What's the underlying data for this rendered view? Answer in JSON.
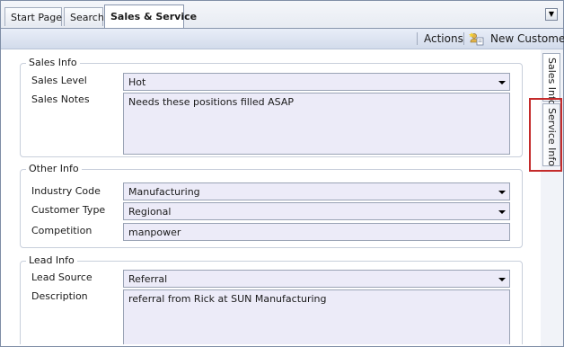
{
  "tabs": [
    {
      "label": "Start Page"
    },
    {
      "label": "Search"
    },
    {
      "label": "Sales & Service",
      "active": true
    }
  ],
  "toolbar": {
    "actions_label": "Actions",
    "new_customer_label": "New Customer"
  },
  "side_tabs": [
    {
      "label": "Sales Info",
      "active": true
    },
    {
      "label": "Service Info",
      "highlighted": true
    }
  ],
  "sales_info": {
    "title": "Sales Info",
    "sales_level_label": "Sales Level",
    "sales_level_value": "Hot",
    "sales_notes_label": "Sales Notes",
    "sales_notes_value": "Needs these positions filled ASAP"
  },
  "other_info": {
    "title": "Other Info",
    "industry_code_label": "Industry Code",
    "industry_code_value": "Manufacturing",
    "customer_type_label": "Customer Type",
    "customer_type_value": "Regional",
    "competition_label": "Competition",
    "competition_value": "manpower"
  },
  "lead_info": {
    "title": "Lead Info",
    "lead_source_label": "Lead Source",
    "lead_source_value": "Referral",
    "description_label": "Description",
    "description_value": "referral from Rick at SUN Manufacturing"
  },
  "colors": {
    "field_bg": "#ecebf8",
    "highlight": "#c42b2b",
    "toolbar": "#d2dbeb"
  }
}
